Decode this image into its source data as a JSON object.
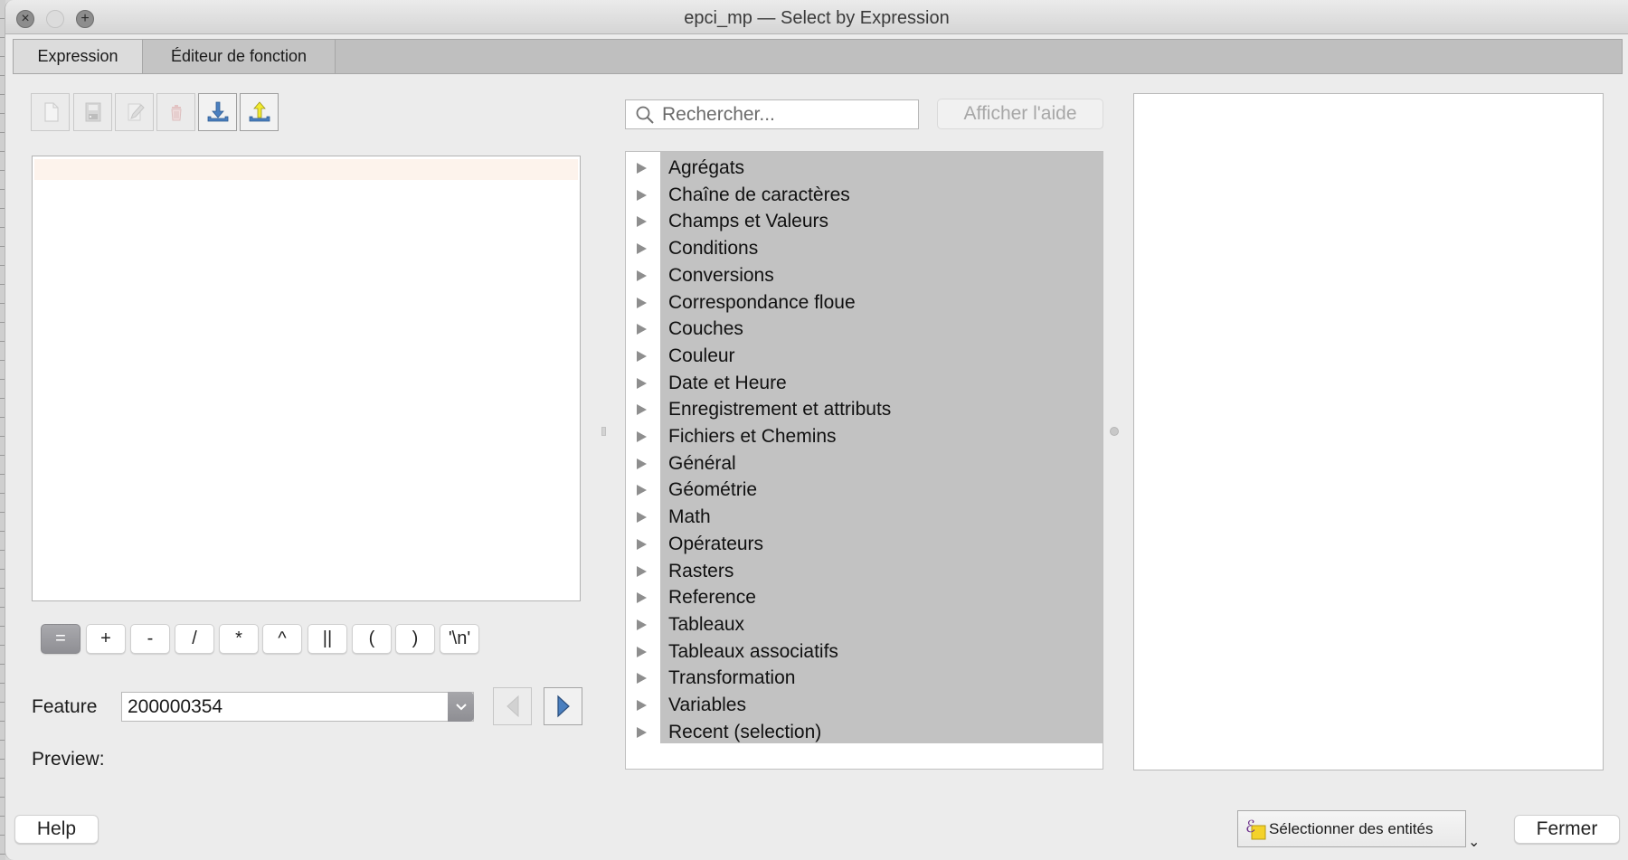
{
  "window": {
    "title": "epci_mp — Select by Expression",
    "controls": {
      "close": "×",
      "minimize": "",
      "zoom": "+"
    }
  },
  "tabs": [
    {
      "label": "Expression",
      "active": true
    },
    {
      "label": "Éditeur de fonction",
      "active": false
    }
  ],
  "toolbar": [
    {
      "name": "new-file",
      "icon": "new-file-icon",
      "enabled": false
    },
    {
      "name": "save",
      "icon": "floppy-disk-icon",
      "enabled": false
    },
    {
      "name": "edit",
      "icon": "pencil-icon",
      "enabled": false
    },
    {
      "name": "delete",
      "icon": "trash-icon",
      "enabled": false
    },
    {
      "name": "import",
      "icon": "import-arrow-icon",
      "enabled": true
    },
    {
      "name": "export",
      "icon": "export-arrow-icon",
      "enabled": true
    }
  ],
  "expression": {
    "value": ""
  },
  "operators": [
    "=",
    "+",
    "-",
    "/",
    "*",
    "^",
    "||",
    "(",
    ")",
    "'\\n'"
  ],
  "feature": {
    "label": "Feature",
    "value": "200000354",
    "prev_enabled": false,
    "next_enabled": true
  },
  "preview": {
    "label": "Preview:",
    "value": ""
  },
  "search": {
    "placeholder": "Rechercher...",
    "value": ""
  },
  "show_help": {
    "label": "Afficher l'aide",
    "enabled": false
  },
  "function_groups": [
    "Agrégats",
    "Chaîne de caractères",
    "Champs et Valeurs",
    "Conditions",
    "Conversions",
    "Correspondance floue",
    "Couches",
    "Couleur",
    "Date et Heure",
    "Enregistrement et attributs",
    "Fichiers et Chemins",
    "Général",
    "Géométrie",
    "Math",
    "Opérateurs",
    "Rasters",
    "Reference",
    "Tableaux",
    "Tableaux associatifs",
    "Transformation",
    "Variables",
    "Recent (selection)"
  ],
  "buttons": {
    "help": "Help",
    "select_features": "Sélectionner des entités",
    "select_dropdown": "⌄",
    "close": "Fermer"
  },
  "colors": {
    "tree_selection": "#c2c2c2",
    "current_line": "#fdf3ec",
    "nav_arrow": "#4a7fbf",
    "import_arrow": "#4a7fbf",
    "export_arrow": "#f2ea2e"
  }
}
